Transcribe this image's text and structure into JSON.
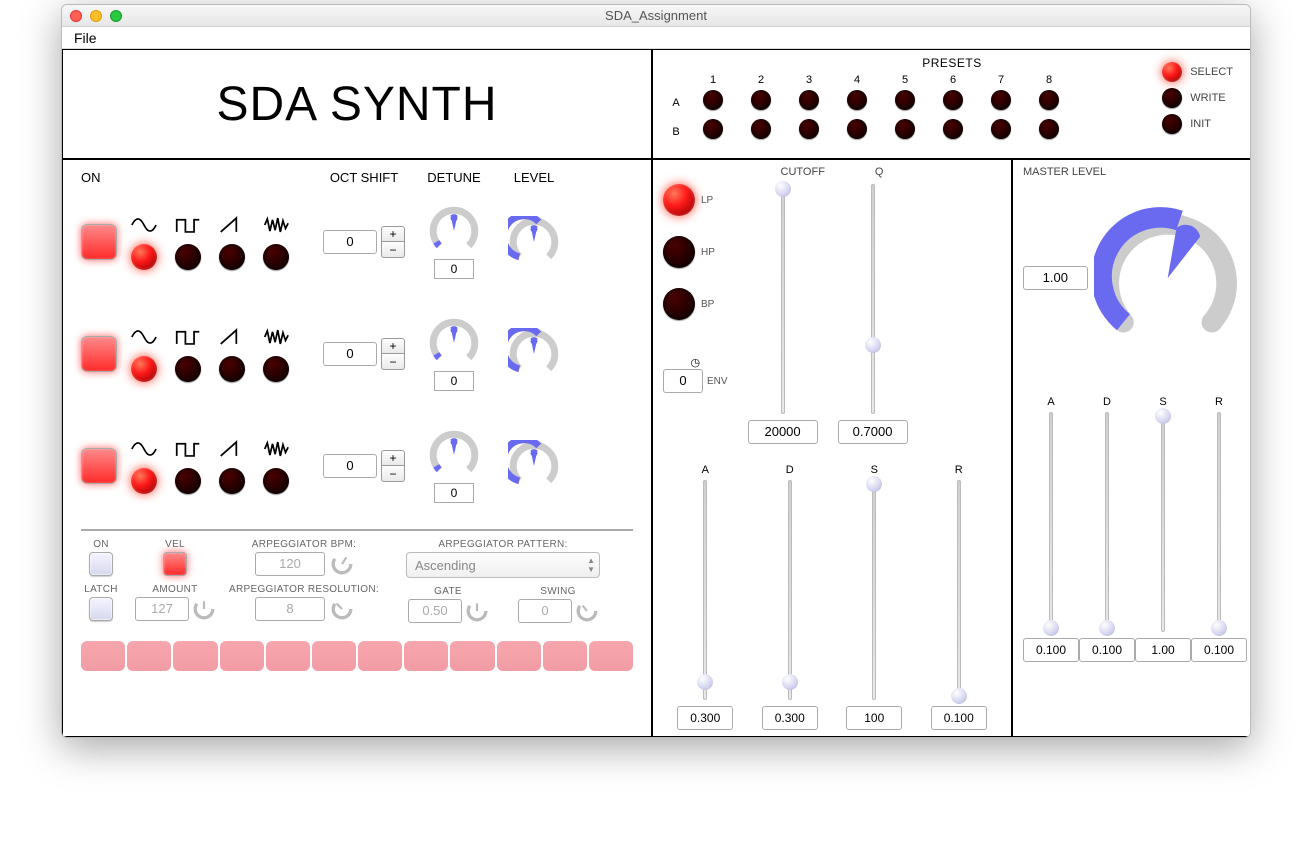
{
  "window": {
    "title": "SDA_Assignment",
    "menu_file": "File"
  },
  "logo": "SDA SYNTH",
  "presets": {
    "title": "PRESETS",
    "nums": [
      "1",
      "2",
      "3",
      "4",
      "5",
      "6",
      "7",
      "8"
    ],
    "rows": [
      "A",
      "B"
    ],
    "select": "SELECT",
    "write": "WRITE",
    "init": "INIT"
  },
  "osc": {
    "on_label": "ON",
    "oct_label": "OCT SHIFT",
    "detune_label": "DETUNE",
    "level_label": "LEVEL",
    "rows": [
      {
        "on": true,
        "oct": "0",
        "detune": "0",
        "wave_sel": 0
      },
      {
        "on": true,
        "oct": "0",
        "detune": "0",
        "wave_sel": 0
      },
      {
        "on": true,
        "oct": "0",
        "detune": "0",
        "wave_sel": 0
      }
    ]
  },
  "arp": {
    "on_label": "ON",
    "vel_label": "VEL",
    "latch_label": "LATCH",
    "amount_label": "AMOUNT",
    "amount_val": "127",
    "bpm_label": "ARPEGGIATOR BPM:",
    "bpm_val": "120",
    "res_label": "ARPEGGIATOR RESOLUTION:",
    "res_val": "8",
    "pattern_label": "ARPEGGIATOR PATTERN:",
    "pattern_val": "Ascending",
    "gate_label": "GATE",
    "gate_val": "0.50",
    "swing_label": "SWING",
    "swing_val": "0",
    "steps": 12
  },
  "filter": {
    "lp": "LP",
    "hp": "HP",
    "bp": "BP",
    "env": "ENV",
    "env_val": "0",
    "cutoff_label": "CUTOFF",
    "q_label": "Q",
    "cutoff_val": "20000",
    "q_val": "0.7000",
    "adsr_labels": [
      "A",
      "D",
      "S",
      "R"
    ],
    "a": "0.300",
    "d": "0.300",
    "s": "100",
    "r": "0.100",
    "a_pos": 0.08,
    "d_pos": 0.08,
    "s_pos": 0.98,
    "r_pos": 0.02
  },
  "master": {
    "label": "MASTER LEVEL",
    "val": "1.00",
    "adsr_labels": [
      "A",
      "D",
      "S",
      "R"
    ],
    "a": "0.100",
    "d": "0.100",
    "s": "1.00",
    "r": "0.100",
    "a_pos": 0.02,
    "d_pos": 0.02,
    "s_pos": 0.98,
    "r_pos": 0.02
  }
}
